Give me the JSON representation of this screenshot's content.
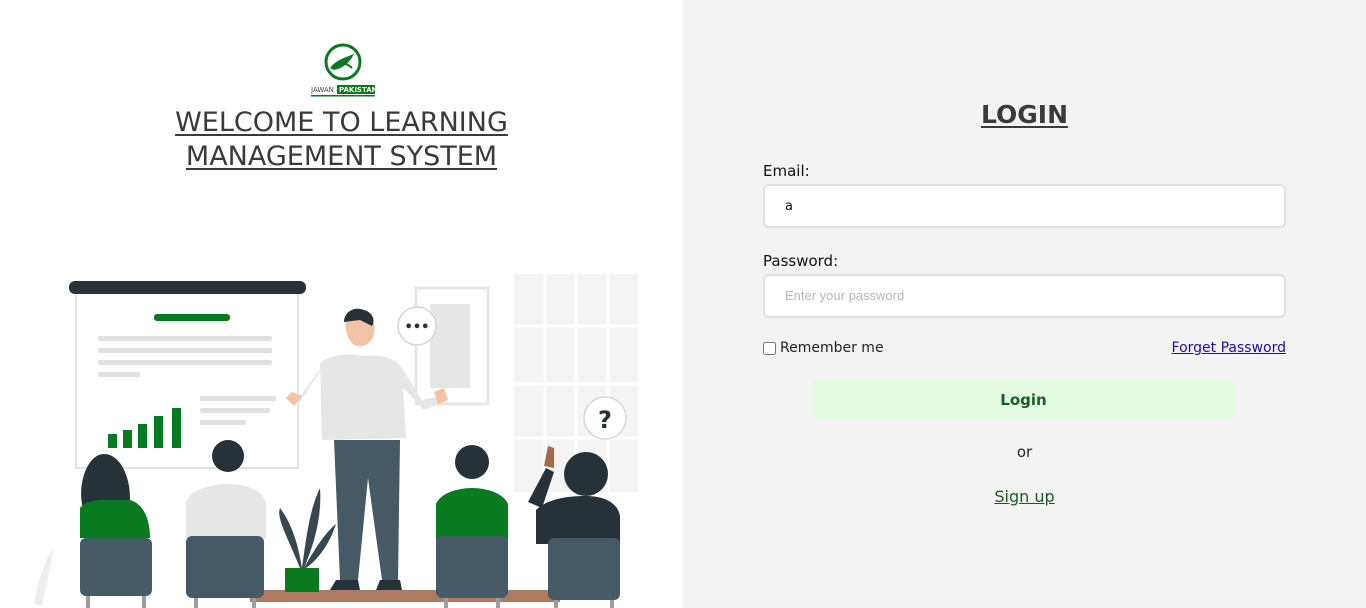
{
  "brand": {
    "logo_text_left": "JAWAN",
    "logo_text_right": "PAKISTAN"
  },
  "welcome": {
    "line1": "WELCOME TO LEARNING",
    "line2": "MANAGEMENT SYSTEM"
  },
  "login": {
    "title": "LOGIN",
    "email_label": "Email:",
    "email_value": "a",
    "password_label": "Password:",
    "password_placeholder": "Enter your password",
    "remember_label": "Remember me",
    "remember_checked": false,
    "forget_label": "Forget Password",
    "login_button": "Login",
    "or_text": "or",
    "signup_label": "Sign up"
  },
  "illustration": {
    "speech_bubble": "•••",
    "question_mark": "?"
  },
  "colors": {
    "brand_green": "#0a7a20",
    "right_bg": "#f3f3f3",
    "button_bg": "#e2fbe2",
    "button_text": "#1b5e20",
    "link_blue": "#1a0dab"
  }
}
